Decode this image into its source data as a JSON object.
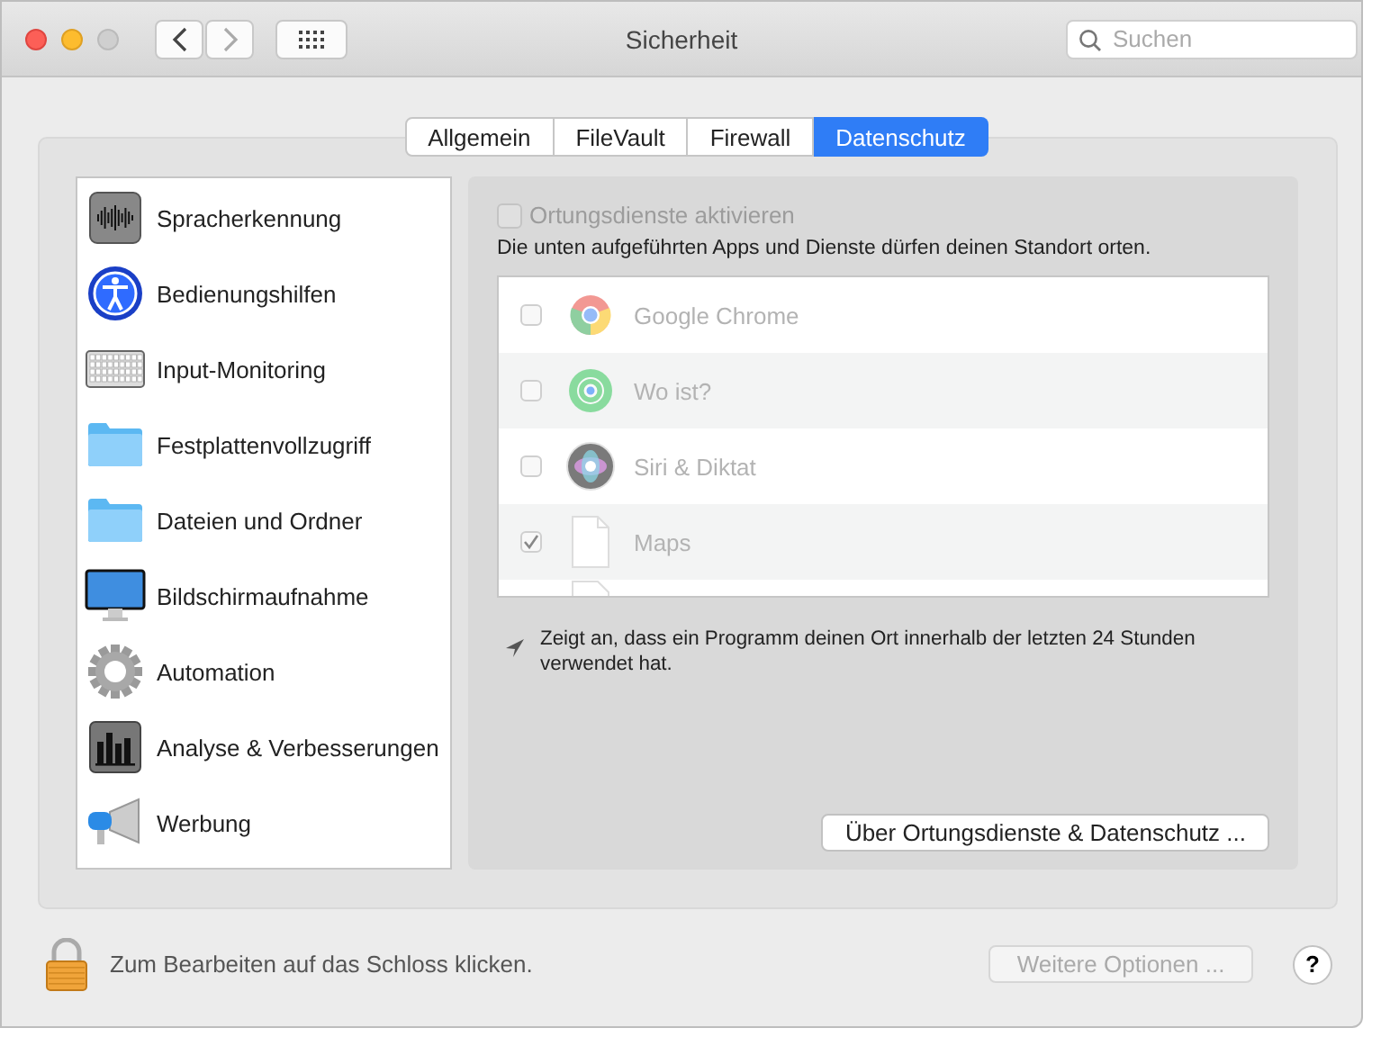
{
  "window": {
    "title": "Sicherheit"
  },
  "search": {
    "placeholder": "Suchen"
  },
  "tabs": [
    {
      "label": "Allgemein",
      "selected": false
    },
    {
      "label": "FileVault",
      "selected": false
    },
    {
      "label": "Firewall",
      "selected": false
    },
    {
      "label": "Datenschutz",
      "selected": true
    }
  ],
  "sidebar": {
    "items": [
      {
        "label": "Spracherkennung"
      },
      {
        "label": "Bedienungshilfen"
      },
      {
        "label": "Input-Monitoring"
      },
      {
        "label": "Festplattenvollzugriff"
      },
      {
        "label": "Dateien und Ordner"
      },
      {
        "label": "Bildschirmaufnahme"
      },
      {
        "label": "Automation"
      },
      {
        "label": "Analyse & Verbesserungen"
      },
      {
        "label": "Werbung"
      }
    ]
  },
  "location": {
    "enable": {
      "label": "Ortungsdienste aktivieren",
      "checked": false,
      "disabled": true
    },
    "description": "Die unten aufgeführten Apps und Dienste dürfen deinen Standort orten.",
    "apps": [
      {
        "name": "Google Chrome",
        "checked": false
      },
      {
        "name": "Wo ist?",
        "checked": false
      },
      {
        "name": "Siri & Diktat",
        "checked": false
      },
      {
        "name": "Maps",
        "checked": true
      }
    ],
    "legend": "Zeigt an, dass ein Programm deinen Ort innerhalb der letzten 24 Stunden verwendet hat.",
    "about_button": "Über Ortungsdienste & Datenschutz ..."
  },
  "footer": {
    "lock_text": "Zum Bearbeiten auf das Schloss klicken.",
    "more_button": {
      "label": "Weitere Optionen ...",
      "disabled": true
    },
    "help": "?"
  }
}
